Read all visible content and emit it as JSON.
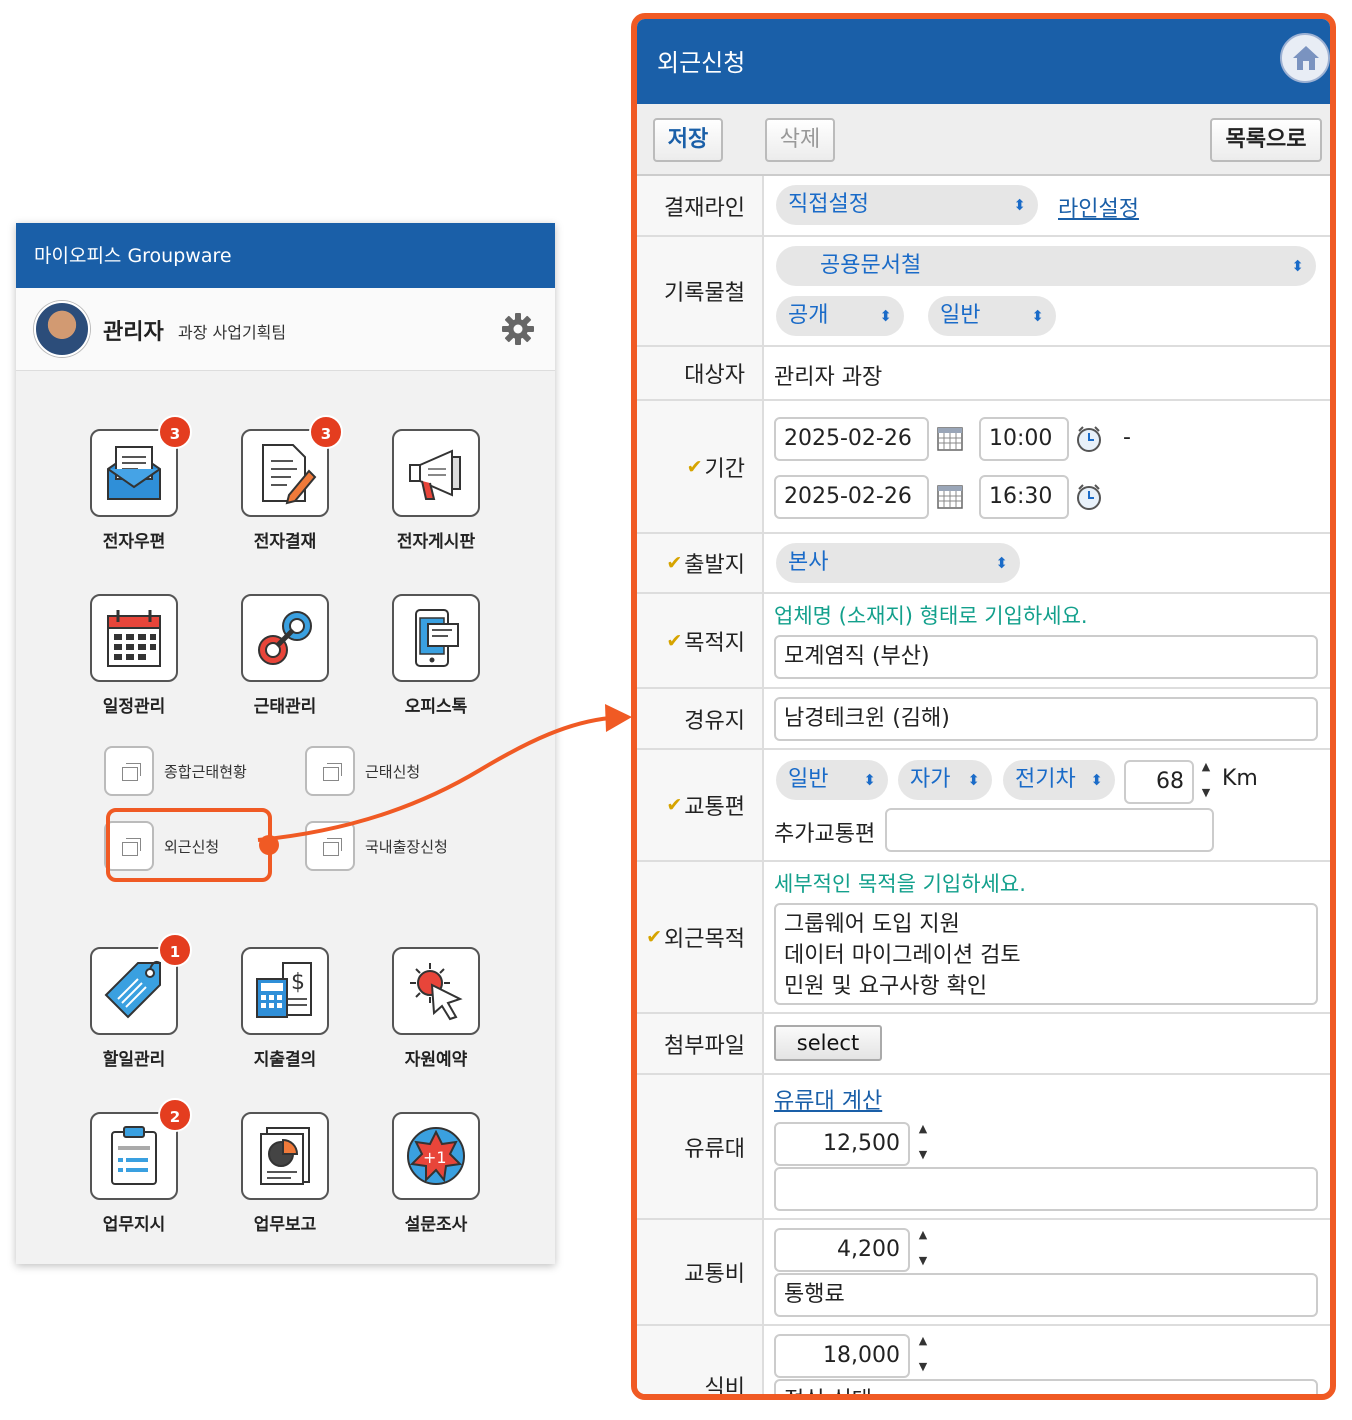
{
  "phone": {
    "header_title": "마이오피스 Groupware",
    "user_name": "관리자",
    "user_sub": "과장 사업기획팀",
    "apps": [
      {
        "label": "전자우편",
        "icon": "mail-icon",
        "badge": "3"
      },
      {
        "label": "전자결재",
        "icon": "document-pen-icon",
        "badge": "3"
      },
      {
        "label": "전자게시판",
        "icon": "megaphone-icon",
        "badge": ""
      },
      {
        "label": "일정관리",
        "icon": "calendar-icon",
        "badge": ""
      },
      {
        "label": "근태관리",
        "icon": "link-icon",
        "badge": ""
      },
      {
        "label": "오피스톡",
        "icon": "chat-phone-icon",
        "badge": ""
      },
      {
        "label": "할일관리",
        "icon": "tag-icon",
        "badge": "1"
      },
      {
        "label": "지출결의",
        "icon": "calculator-dollar-icon",
        "badge": ""
      },
      {
        "label": "자원예약",
        "icon": "cursor-click-icon",
        "badge": ""
      },
      {
        "label": "업무지시",
        "icon": "clipboard-icon",
        "badge": "2"
      },
      {
        "label": "업무보고",
        "icon": "report-chart-icon",
        "badge": ""
      },
      {
        "label": "설문조사",
        "icon": "plus-one-icon",
        "badge": ""
      }
    ],
    "submenu": [
      "종합근태현황",
      "근태신청",
      "외근신청",
      "국내출장신청"
    ]
  },
  "form": {
    "title": "외근신청",
    "toolbar": {
      "save": "저장",
      "delete": "삭제",
      "list": "목록으로"
    },
    "approval": {
      "label": "결재라인",
      "select": "직접설정",
      "link": "라인설정"
    },
    "records": {
      "label": "기록물철",
      "folder": "공용문서철",
      "visibility": "공개",
      "grade": "일반"
    },
    "target": {
      "label": "대상자",
      "value": "관리자 과장"
    },
    "period": {
      "label": "기간",
      "start_date": "2025-02-26",
      "start_time": "10:00",
      "dash": "-",
      "end_date": "2025-02-26",
      "end_time": "16:30"
    },
    "departure": {
      "label": "출발지",
      "value": "본사"
    },
    "destination": {
      "label": "목적지",
      "hint": "업체명 (소재지) 형태로 기입하세요.",
      "value": "모계염직 (부산)"
    },
    "waypoint": {
      "label": "경유지",
      "value": "남경테크윈 (김해)"
    },
    "transport": {
      "label": "교통편",
      "type": "일반",
      "owner": "자가",
      "vehicle": "전기차",
      "distance": "68",
      "unit": "Km",
      "extra_label": "추가교통편",
      "extra_value": ""
    },
    "purpose": {
      "label": "외근목적",
      "hint": "세부적인 목적을 기입하세요.",
      "lines": [
        "그룹웨어 도입 지원",
        "데이터 마이그레이션 검토",
        "민원 및 요구사항 확인"
      ]
    },
    "attachment": {
      "label": "첨부파일",
      "button": "select"
    },
    "fuel": {
      "label": "유류대",
      "link": "유류대 계산",
      "amount": "12,500",
      "note": ""
    },
    "transit_fee": {
      "label": "교통비",
      "amount": "4,200",
      "note": "통행료"
    },
    "meal": {
      "label": "식비",
      "amount": "18,000",
      "note": "점심 식대"
    }
  },
  "colors": {
    "brand_blue": "#1a5fa8",
    "accent_orange": "#f05a24",
    "badge_red": "#e43d1f",
    "hint_teal": "#13a08c"
  }
}
